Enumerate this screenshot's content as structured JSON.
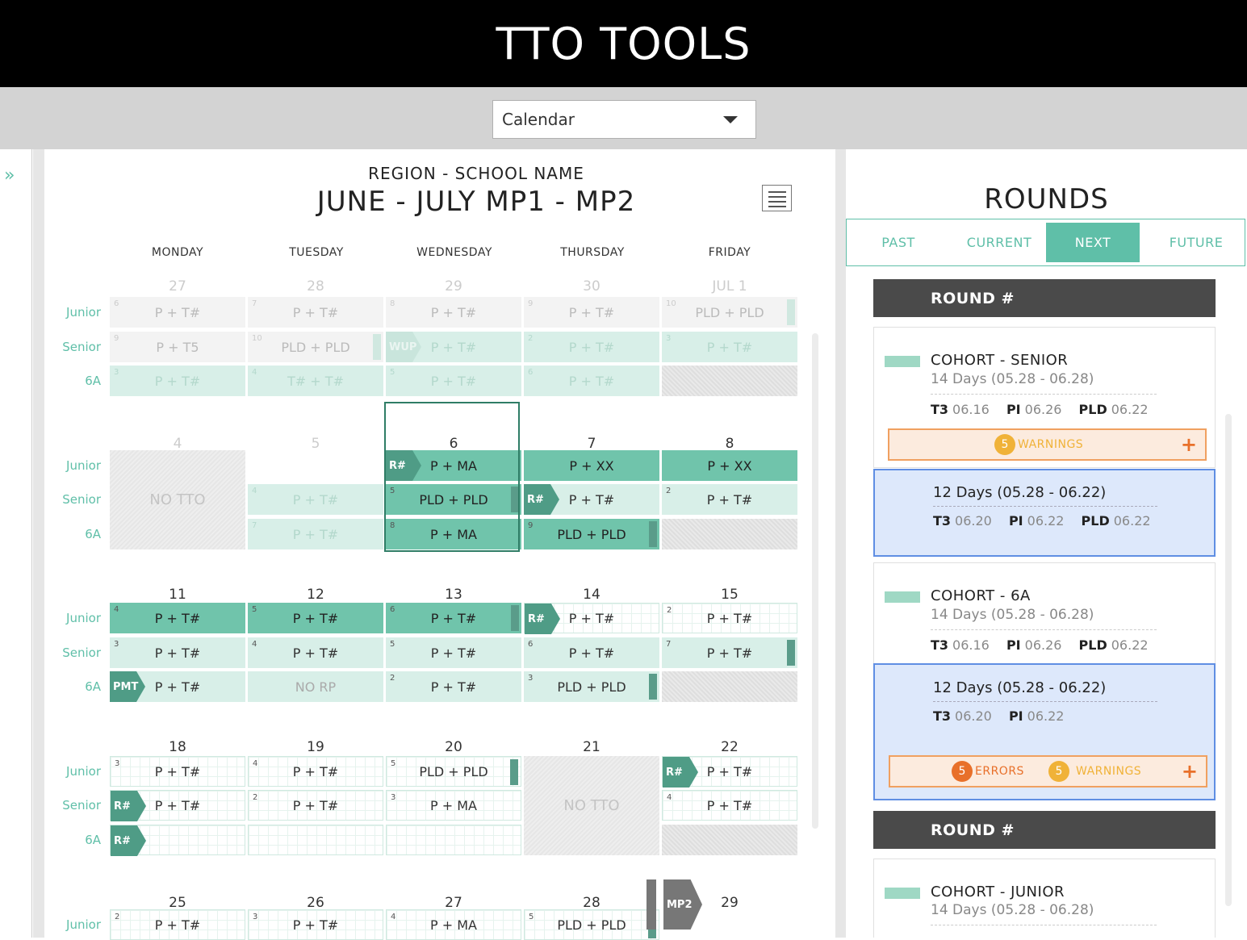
{
  "app": {
    "title": "TTO TOOLS"
  },
  "view_select": {
    "value": "Calendar"
  },
  "leftrail": {
    "expand_glyph": "»"
  },
  "calendar": {
    "region": "REGION - SCHOOL NAME",
    "title": "JUNE - JULY  MP1 - MP2",
    "days": [
      "MONDAY",
      "TUESDAY",
      "WEDNESDAY",
      "THURSDAY",
      "FRIDAY"
    ],
    "row_labels": [
      "Junior",
      "Senior",
      "6A"
    ],
    "weeks": [
      {
        "dates": [
          "27",
          "28",
          "29",
          "30",
          "JUL 1"
        ]
      },
      {
        "dates": [
          "4",
          "5",
          "6",
          "7",
          "8"
        ]
      },
      {
        "dates": [
          "11",
          "12",
          "13",
          "14",
          "15"
        ]
      },
      {
        "dates": [
          "18",
          "19",
          "20",
          "21",
          "22"
        ]
      },
      {
        "dates": [
          "25",
          "26",
          "27",
          "28",
          "29"
        ]
      }
    ],
    "cells": {
      "w1": {
        "junior": [
          {
            "n": "6",
            "t": "P + T#"
          },
          {
            "n": "7",
            "t": "P + T#"
          },
          {
            "n": "8",
            "t": "P + T#"
          },
          {
            "n": "9",
            "t": "P + T#"
          },
          {
            "n": "10",
            "t": "PLD + PLD"
          }
        ],
        "senior": [
          {
            "n": "9",
            "t": "P + T5"
          },
          {
            "n": "10",
            "t": "PLD + PLD"
          },
          {
            "tag": "WUP",
            "t": "P + T#"
          },
          {
            "n": "2",
            "t": "P + T#"
          },
          {
            "n": "3",
            "t": "P + T#"
          }
        ],
        "sixa": [
          {
            "n": "3",
            "t": "P + T#"
          },
          {
            "n": "4",
            "t": "T# + T#"
          },
          {
            "n": "5",
            "t": "P + T#"
          },
          {
            "n": "6",
            "t": "P + T#"
          }
        ]
      },
      "w2": {
        "notto": "NO TTO",
        "junior": [
          {
            "tag": "R#",
            "t": "P + MA"
          },
          {
            "t": "P + XX"
          },
          {
            "t": "P + XX"
          }
        ],
        "senior": [
          {
            "n": "4",
            "t": "P + T#"
          },
          {
            "n": "5",
            "t": "PLD + PLD"
          },
          {
            "tag": "R#",
            "t": "P + T#"
          },
          {
            "n": "2",
            "t": "P + T#"
          }
        ],
        "sixa": [
          {
            "n": "7",
            "t": "P + T#"
          },
          {
            "n": "8",
            "t": "P + MA"
          },
          {
            "n": "9",
            "t": "PLD + PLD"
          }
        ]
      },
      "w3": {
        "junior": [
          {
            "n": "4",
            "t": "P + T#"
          },
          {
            "n": "5",
            "t": "P + T#"
          },
          {
            "n": "6",
            "t": "P + T#"
          },
          {
            "tag": "R#",
            "t": "P + T#"
          },
          {
            "n": "2",
            "t": "P + T#"
          }
        ],
        "senior": [
          {
            "n": "3",
            "t": "P + T#"
          },
          {
            "n": "4",
            "t": "P + T#"
          },
          {
            "n": "5",
            "t": "P + T#"
          },
          {
            "n": "6",
            "t": "P + T#"
          },
          {
            "n": "7",
            "t": "P + T#"
          }
        ],
        "sixa": [
          {
            "tag": "PMT",
            "t": "P + T#"
          },
          {
            "t": "NO RP"
          },
          {
            "n": "2",
            "t": "P + T#"
          },
          {
            "n": "3",
            "t": "PLD + PLD"
          }
        ]
      },
      "w4": {
        "notto": "NO TTO",
        "junior": [
          {
            "n": "3",
            "t": "P + T#"
          },
          {
            "n": "4",
            "t": "P + T#"
          },
          {
            "n": "5",
            "t": "PLD + PLD"
          },
          {
            "tag": "R#",
            "t": "P + T#"
          }
        ],
        "senior": [
          {
            "tag": "R#",
            "t": "P + T#"
          },
          {
            "n": "2",
            "t": "P + T#"
          },
          {
            "n": "3",
            "t": "P + MA"
          },
          {
            "n": "4",
            "t": "P + T#"
          }
        ],
        "sixa": [
          {
            "tag": "R#"
          }
        ]
      },
      "w5": {
        "mp2": "MP2",
        "junior": [
          {
            "n": "2",
            "t": "P + T#"
          },
          {
            "n": "3",
            "t": "P + T#"
          },
          {
            "n": "4",
            "t": "P + MA"
          },
          {
            "n": "5",
            "t": "PLD + PLD"
          }
        ]
      }
    }
  },
  "rounds": {
    "title": "ROUNDS",
    "tabs": [
      "PAST",
      "CURRENT",
      "NEXT",
      "FUTURE"
    ],
    "active_tab": "NEXT",
    "round_label": "ROUND #",
    "senior": {
      "name": "COHORT - SENIOR",
      "days": "14 Days (05.28 - 06.28)",
      "t3": "06.16",
      "pi": "06.26",
      "pld": "06.22",
      "warnings": "5",
      "warnings_label": "WARNINGS"
    },
    "senior_sub": {
      "days": "12 Days (05.28 - 06.22)",
      "t3": "06.20",
      "pi": "06.22",
      "pld": "06.22"
    },
    "sixa": {
      "name": "COHORT - 6A",
      "days": "14 Days (05.28 - 06.28)",
      "t3": "06.16",
      "pi": "06.26",
      "pld": "06.22"
    },
    "sixa_sub": {
      "days": "12 Days (05.28 - 06.22)",
      "t3": "06.20",
      "pi": "06.22",
      "errors": "5",
      "errors_label": "ERRORS",
      "warnings": "5",
      "warnings_label": "WARNINGS"
    },
    "junior": {
      "name": "COHORT - JUNIOR",
      "days": "14 Days (05.28 - 06.28)"
    },
    "metric_keys": {
      "t3": "T3",
      "pi": "PI",
      "pld": "PLD"
    },
    "plus": "+"
  },
  "colors": {
    "teal": "#70c4ab",
    "mint": "#d8efe8",
    "accent": "#5fbfa8",
    "warning": "#f0b238",
    "error": "#e8702a",
    "selection": "#5f8ee3"
  }
}
